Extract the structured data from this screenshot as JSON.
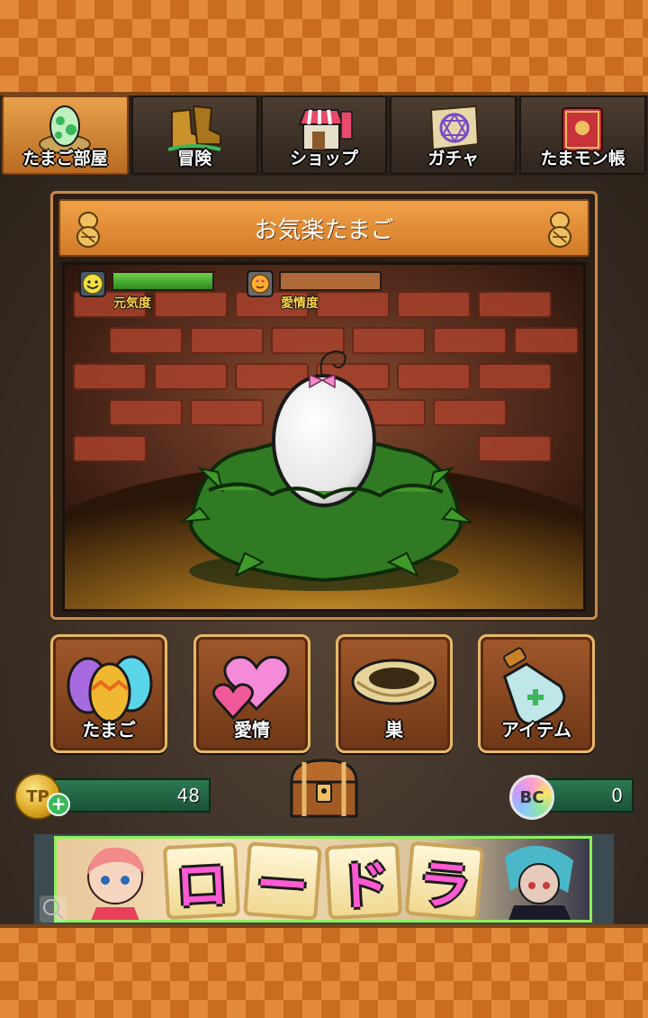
{
  "tabs": [
    {
      "label": "たまご部屋",
      "icon": "egg-nest-icon",
      "active": true
    },
    {
      "label": "冒険",
      "icon": "boots-icon",
      "active": false
    },
    {
      "label": "ショップ",
      "icon": "shop-icon",
      "active": false
    },
    {
      "label": "ガチャ",
      "icon": "gacha-scroll-icon",
      "active": false
    },
    {
      "label": "たまモン帳",
      "icon": "book-icon",
      "active": false
    }
  ],
  "panel": {
    "title": "お気楽たまご",
    "stats": [
      {
        "label": "元気度",
        "icon": "smiley-icon",
        "fill": 1.0
      },
      {
        "label": "愛情度",
        "icon": "heart-face-icon",
        "fill": 0.0
      }
    ]
  },
  "actions": [
    {
      "label": "たまご",
      "icon": "eggs-icon"
    },
    {
      "label": "愛情",
      "icon": "hearts-icon"
    },
    {
      "label": "巣",
      "icon": "nest-icon"
    },
    {
      "label": "アイテム",
      "icon": "potion-icon"
    }
  ],
  "currency": {
    "tp_label": "TP",
    "tp_value": "48",
    "bc_label": "BC",
    "bc_value": "0"
  },
  "banner": {
    "tiles": [
      "ロ",
      "ー",
      "ド",
      "ラ"
    ]
  },
  "colors": {
    "orange": "#e38a3a",
    "tab_active": "#e8a24c",
    "meter_green": "#4cb53a",
    "currency_green": "#2c7a52"
  }
}
